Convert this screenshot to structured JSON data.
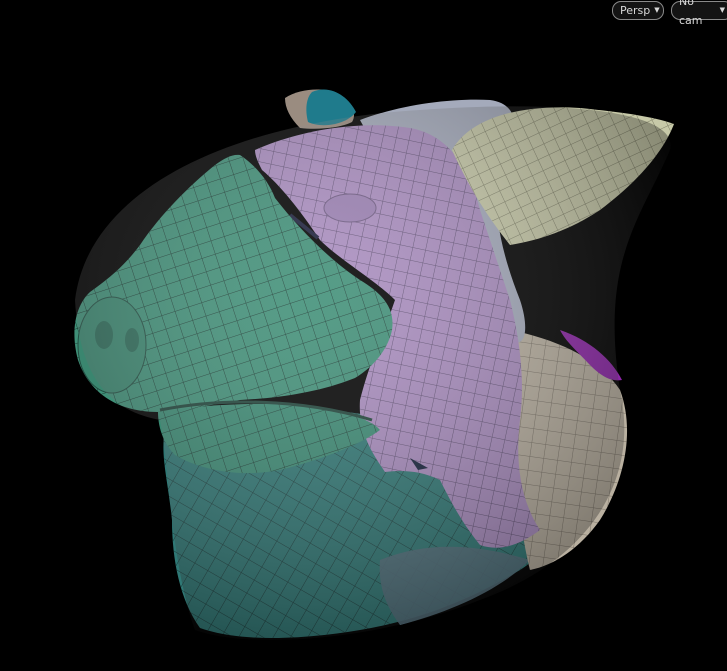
{
  "viewport": {
    "projection_menu": {
      "label": "Persp",
      "icon": "chevron-down-icon"
    },
    "camera_menu": {
      "label": "No cam",
      "icon": "chevron-down-icon"
    }
  },
  "model": {
    "subject": "pig-head-mesh",
    "colors": {
      "background": "#000000",
      "green": "#3f8f77",
      "teal": "#2f7875",
      "purple": "#a98cbf",
      "cream": "#c7c9a8",
      "tan": "#b9b0a0",
      "lavender": "#a4aabb",
      "wire": "#1d2a2a"
    }
  }
}
